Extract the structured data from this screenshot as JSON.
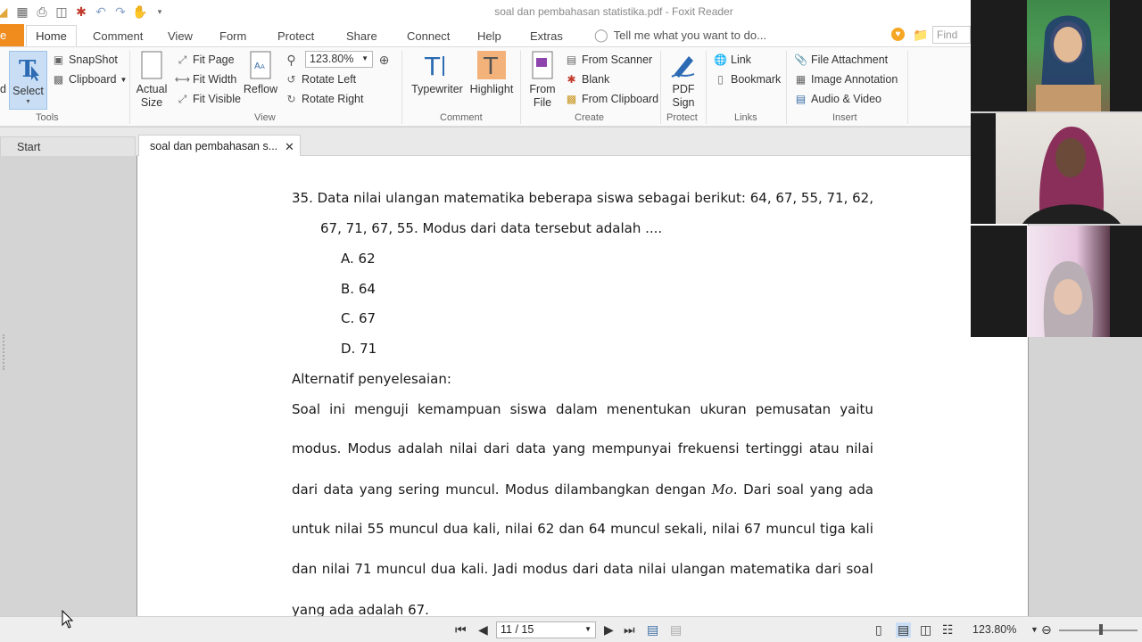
{
  "window": {
    "title": "soal dan pembahasan statistika.pdf - Foxit Reader"
  },
  "menu_tabs": [
    {
      "label": "e"
    },
    {
      "label": "Home"
    },
    {
      "label": "Comment"
    },
    {
      "label": "View"
    },
    {
      "label": "Form"
    },
    {
      "label": "Protect"
    },
    {
      "label": "Share"
    },
    {
      "label": "Connect"
    },
    {
      "label": "Help"
    },
    {
      "label": "Extras"
    }
  ],
  "tell_me": "Tell me what you want to do...",
  "find_placeholder": "Find",
  "ribbon": {
    "tools": {
      "select": "Select",
      "snapshot": "SnapShot",
      "clipboard": "Clipboard",
      "label": "Tools",
      "cut_off": "d"
    },
    "view": {
      "actual_size_1": "Actual",
      "actual_size_2": "Size",
      "fit_page": "Fit Page",
      "fit_width": "Fit Width",
      "fit_visible": "Fit Visible",
      "reflow": "Reflow",
      "zoom": "123.80%",
      "rotate_left": "Rotate Left",
      "rotate_right": "Rotate Right",
      "label": "View"
    },
    "comment": {
      "typewriter": "Typewriter",
      "highlight": "Highlight",
      "label": "Comment"
    },
    "create": {
      "from_file_1": "From",
      "from_file_2": "File",
      "from_scanner": "From Scanner",
      "blank": "Blank",
      "from_clipboard": "From Clipboard",
      "label": "Create"
    },
    "protect": {
      "pdf_sign_1": "PDF",
      "pdf_sign_2": "Sign",
      "label": "Protect"
    },
    "links": {
      "link": "Link",
      "bookmark": "Bookmark",
      "label": "Links"
    },
    "insert": {
      "file_attachment": "File Attachment",
      "image_annotation": "Image Annotation",
      "audio_video": "Audio & Video",
      "label": "Insert"
    }
  },
  "doc_tabs": {
    "start": "Start",
    "document": "soal dan pembahasan s..."
  },
  "document": {
    "question_line1": [
      "35.",
      "Data",
      "nilai",
      "ulangan",
      "matematika",
      "beberapa",
      "siswa",
      "sebagai",
      "berikut:",
      "64,",
      "67,",
      "55,",
      "71,",
      "62,"
    ],
    "question_line2": "67, 71, 67, 55. Modus dari data tersebut adalah ....",
    "options": [
      "A. 62",
      "B. 64",
      "C. 67",
      "D. 71"
    ],
    "solution_heading": "Alternatif penyelesaian:",
    "para_lines": [
      [
        "Soal",
        "ini",
        "menguji",
        "kemampuan",
        "siswa",
        "dalam",
        "menentukan",
        "ukuran",
        "pemusatan",
        "yaitu"
      ],
      [
        "modus.",
        "Modus",
        "adalah",
        "nilai",
        "dari",
        "data",
        "yang",
        "mempunyai",
        "frekuensi",
        "tertinggi",
        "atau",
        "nilai"
      ],
      [
        "dari",
        "data",
        "yang",
        "sering",
        "muncul.",
        "Modus",
        "dilambangkan",
        "dengan",
        "Mo.",
        "Dari",
        "soal",
        "yang",
        "ada"
      ],
      [
        "untuk",
        "nilai",
        "55",
        "muncul",
        "dua",
        "kali,",
        "nilai",
        "62",
        "dan",
        "64",
        "muncul",
        "sekali,",
        "nilai",
        "67",
        "muncul",
        "tiga",
        "kali"
      ],
      [
        "dan",
        "nilai",
        "71",
        "muncul",
        "dua",
        "kali.",
        "Jadi",
        "modus",
        "dari",
        "data",
        "nilai",
        "ulangan",
        "matematika",
        "dari",
        "soal"
      ]
    ],
    "para_last": "yang ada adalah 67."
  },
  "statusbar": {
    "page": "11 / 15",
    "zoom": "123.80%"
  },
  "colors": {
    "accent": "#f08c1e",
    "select_bg": "#c9def5"
  }
}
